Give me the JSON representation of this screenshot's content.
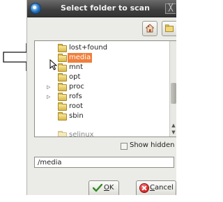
{
  "window": {
    "title": "Select folder to scan",
    "close_glyph": "╳"
  },
  "toolbar": {
    "home_icon": "home-icon",
    "new_folder_icon": "new-folder-icon"
  },
  "folders": [
    {
      "label": "lost+found",
      "expandable": false,
      "selected": false
    },
    {
      "label": "media",
      "expandable": false,
      "selected": true
    },
    {
      "label": "mnt",
      "expandable": false,
      "selected": false
    },
    {
      "label": "opt",
      "expandable": false,
      "selected": false
    },
    {
      "label": "proc",
      "expandable": true,
      "selected": false
    },
    {
      "label": "rofs",
      "expandable": true,
      "selected": false
    },
    {
      "label": "root",
      "expandable": false,
      "selected": false
    },
    {
      "label": "sbin",
      "expandable": false,
      "selected": false
    },
    {
      "label": "selinux",
      "expandable": false,
      "selected": false
    }
  ],
  "options": {
    "show_hidden_label": "Show hidden directories",
    "show_hidden_checked": false
  },
  "path": {
    "value": "/media"
  },
  "buttons": {
    "ok_label": "OK",
    "ok_mnemonic": "O",
    "ok_rest": "K",
    "cancel_label": "Cancel",
    "cancel_mnemonic": "C",
    "cancel_rest": "ancel"
  },
  "colors": {
    "selection": "#f07f3c",
    "titlebar": "#3e3e3e"
  }
}
